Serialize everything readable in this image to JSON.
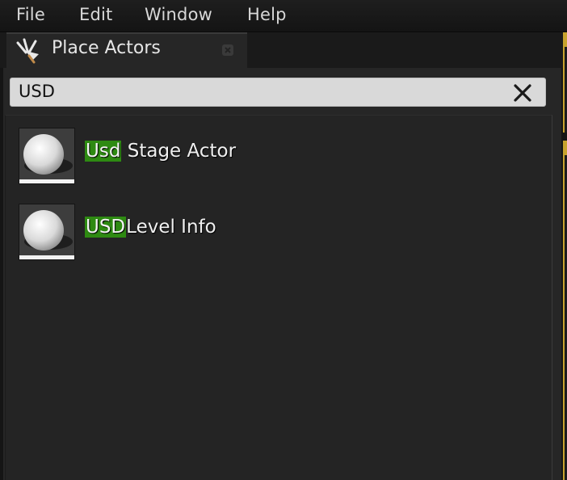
{
  "menubar": {
    "items": [
      "File",
      "Edit",
      "Window",
      "Help"
    ]
  },
  "tab": {
    "title": "Place Actors",
    "icon": "place-actors-icon",
    "close_icon": "close-icon"
  },
  "search": {
    "value": "USD",
    "clear_icon": "clear-x-icon"
  },
  "results": [
    {
      "match": "Usd",
      "rest": " Stage Actor",
      "icon": "sphere-actor-icon"
    },
    {
      "match": "USD",
      "rest": "Level Info",
      "icon": "sphere-actor-icon"
    }
  ],
  "colors": {
    "highlight": "#2e8a12",
    "accent": "#c8a32e",
    "panel": "#262626"
  }
}
